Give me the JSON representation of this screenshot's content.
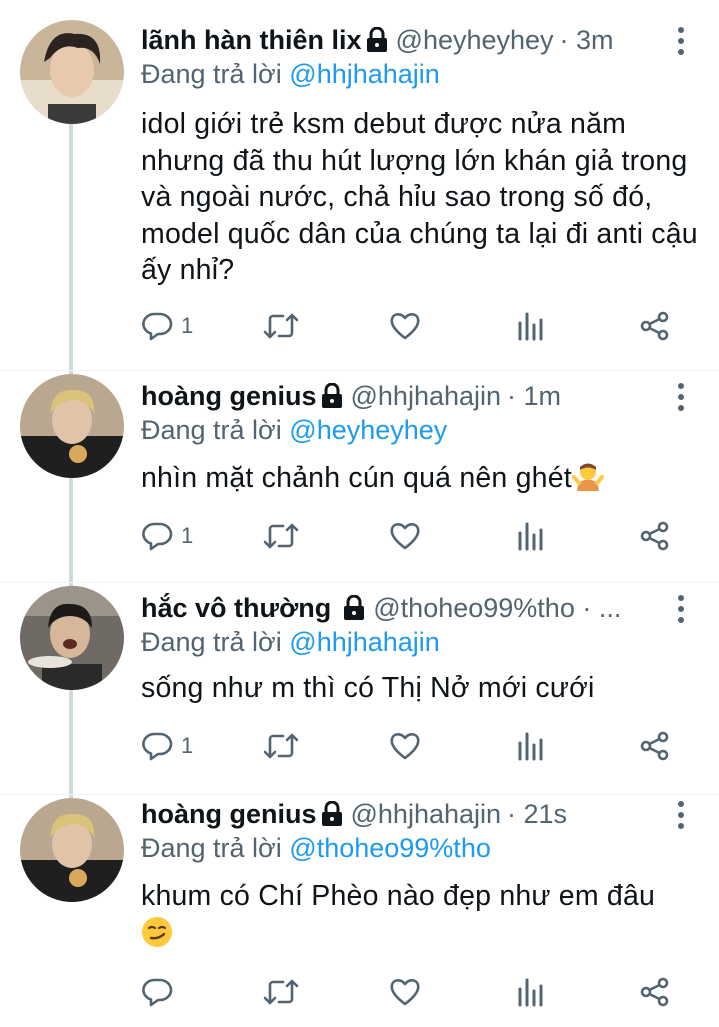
{
  "thread": [
    {
      "display_name": "lãnh hàn thiên lix",
      "handle": "@heyheyhey",
      "time": "· 3m",
      "reply_prefix": "Đang trả lời",
      "reply_to": "@hhjhahajin",
      "text": "idol giới trẻ ksm debut được nửa năm nhưng đã thu hút lượng lớn khán giả trong và ngoài nước, chả hỉu sao trong số đó, model quốc dân của chúng ta lại đi anti cậu ấy nhỉ?",
      "reply_count": "1",
      "emoji": ""
    },
    {
      "display_name": "hoàng genius",
      "handle": "@hhjhahajin",
      "time": "· 1m",
      "reply_prefix": "Đang trả lời",
      "reply_to": "@heyheyhey",
      "text": "nhìn mặt chảnh cún quá nên ghét",
      "reply_count": "1",
      "emoji": "person-shrugging"
    },
    {
      "display_name": "hắc vô thường",
      "handle": "@thoheo99%tho · ...",
      "time": "",
      "reply_prefix": "Đang trả lời",
      "reply_to": "@hhjhahajin",
      "text": "sống như m thì có Thị Nở mới cưới",
      "reply_count": "1",
      "emoji": ""
    },
    {
      "display_name": "hoàng genius",
      "handle": "@hhjhahajin",
      "time": "· 21s",
      "reply_prefix": "Đang trả lời",
      "reply_to": "@thoheo99%tho",
      "text": "khum có Chí Phèo nào đẹp như em đâu",
      "reply_count": "",
      "emoji": "smirking-face"
    }
  ],
  "icons": {
    "reply": "reply-icon",
    "retweet": "retweet-icon",
    "like": "heart-icon",
    "analytics": "analytics-icon",
    "share": "share-icon",
    "lock": "lock-icon",
    "more": "more-vertical-icon"
  },
  "colors": {
    "text": "#0f1419",
    "secondary": "#536471",
    "accent": "#1d9bf0",
    "thread_line": "#cfd9de"
  }
}
